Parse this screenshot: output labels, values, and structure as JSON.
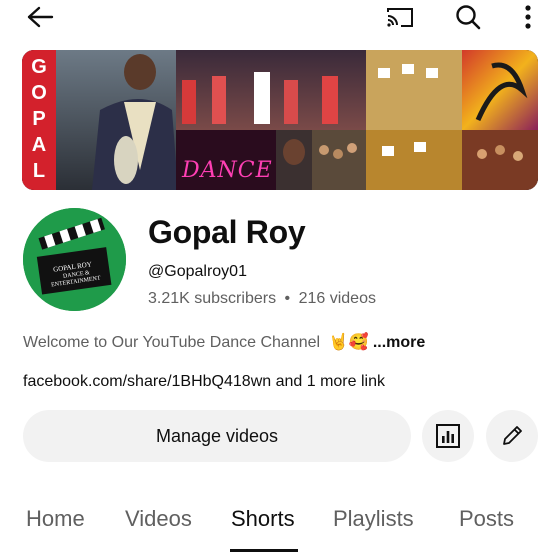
{
  "topbar": {
    "back_icon": "arrow-left-icon",
    "cast_icon": "cast-icon",
    "search_icon": "search-icon",
    "more_icon": "more-vertical-icon"
  },
  "banner": {
    "vertical_text": [
      "G",
      "O",
      "P",
      "A",
      "L"
    ],
    "neon_text": "DANCE"
  },
  "avatar": {
    "line1": "GOPAL ROY",
    "line2": "DANCE &",
    "line3": "ENTERTAINMENT"
  },
  "channel": {
    "name": "Gopal Roy",
    "handle": "@Gopalroy01",
    "subscribers": "3.21K subscribers",
    "separator": "•",
    "videos": "216 videos"
  },
  "description": {
    "text": "Welcome to Our YouTube Dance Channel",
    "emoji": "🤘🥰",
    "more_label": "...more"
  },
  "links": {
    "text": "facebook.com/share/1BHbQ418wn and 1 more link"
  },
  "actions": {
    "manage_label": "Manage videos",
    "analytics_icon": "analytics-icon",
    "edit_icon": "pencil-icon"
  },
  "tabs": [
    {
      "label": "Home"
    },
    {
      "label": "Videos"
    },
    {
      "label": "Shorts",
      "active": true
    },
    {
      "label": "Playlists"
    },
    {
      "label": "Posts"
    }
  ],
  "colors": {
    "avatar_bg": "#1f9b4a",
    "button_bg": "#f2f2f2",
    "secondary_text": "#606060",
    "primary_text": "#0f0f0f",
    "neon_pink": "#ff3fb4"
  }
}
